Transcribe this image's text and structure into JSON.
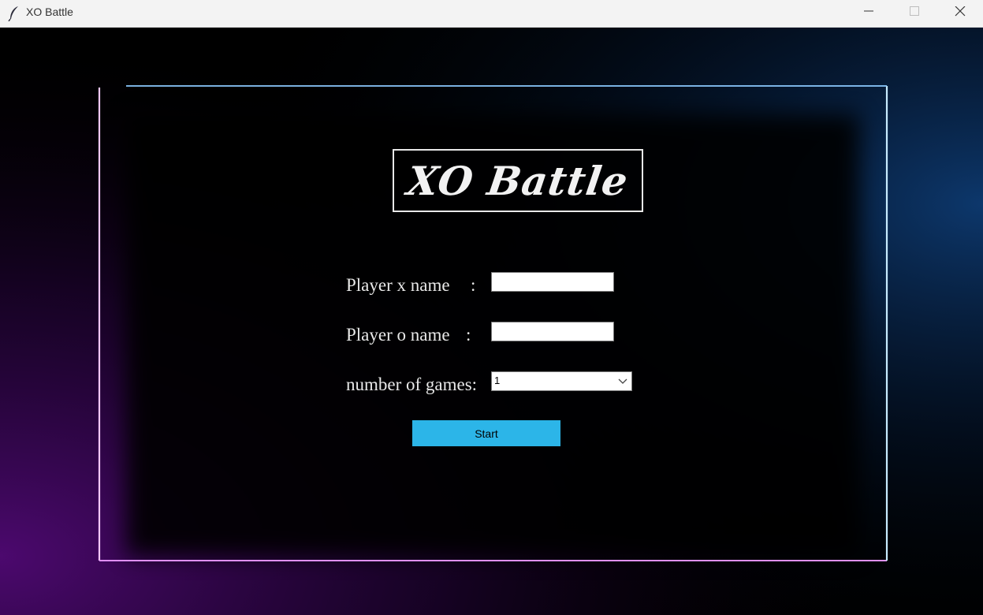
{
  "window": {
    "title": "XO Battle",
    "icon": "feather-icon",
    "controls": [
      "minimize-icon",
      "maximize-icon",
      "close-icon"
    ]
  },
  "logo": {
    "text": "XO Battle"
  },
  "form": {
    "player_x_label": "Player x name",
    "player_o_label": "Player o name",
    "games_label": "number of games:",
    "colon": ":",
    "player_x_value": "",
    "player_o_value": "",
    "games_selected": "1",
    "start_label": "Start"
  },
  "colors": {
    "background": "#000000",
    "frame_left": "#c13cf5",
    "frame_right": "#3aa0ff",
    "button": "#2cb5e8",
    "text": "#e9e9e9"
  }
}
